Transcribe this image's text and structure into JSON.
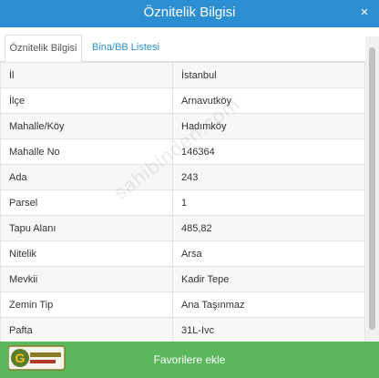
{
  "dialog": {
    "title": "Öznitelik Bilgisi",
    "close_label": "×"
  },
  "tabs": [
    {
      "label": "Öznitelik Bilgisi",
      "active": true
    },
    {
      "label": "Bina/BB Listesi",
      "active": false
    }
  ],
  "attributes": [
    {
      "key": "İl",
      "value": "İstanbul"
    },
    {
      "key": "İlçe",
      "value": "Arnavutköy"
    },
    {
      "key": "Mahalle/Köy",
      "value": "Hadımköy"
    },
    {
      "key": "Mahalle No",
      "value": "146364"
    },
    {
      "key": "Ada",
      "value": "243"
    },
    {
      "key": "Parsel",
      "value": "1"
    },
    {
      "key": "Tapu Alanı",
      "value": "485,82"
    },
    {
      "key": "Nitelik",
      "value": "Arsa"
    },
    {
      "key": "Mevkii",
      "value": "Kadir Tepe"
    },
    {
      "key": "Zemin Tip",
      "value": "Ana Taşınmaz"
    },
    {
      "key": "Pafta",
      "value": "31L-Ivc"
    }
  ],
  "footer": {
    "favorite_label": "Favorilere ekle"
  },
  "watermark": "sahibinden.com",
  "logo": {
    "letter": "G",
    "text": "Gayrimenkul"
  },
  "colors": {
    "header": "#2b8fd1",
    "footer": "#5cb85c",
    "tab_link": "#2b8fd1"
  }
}
